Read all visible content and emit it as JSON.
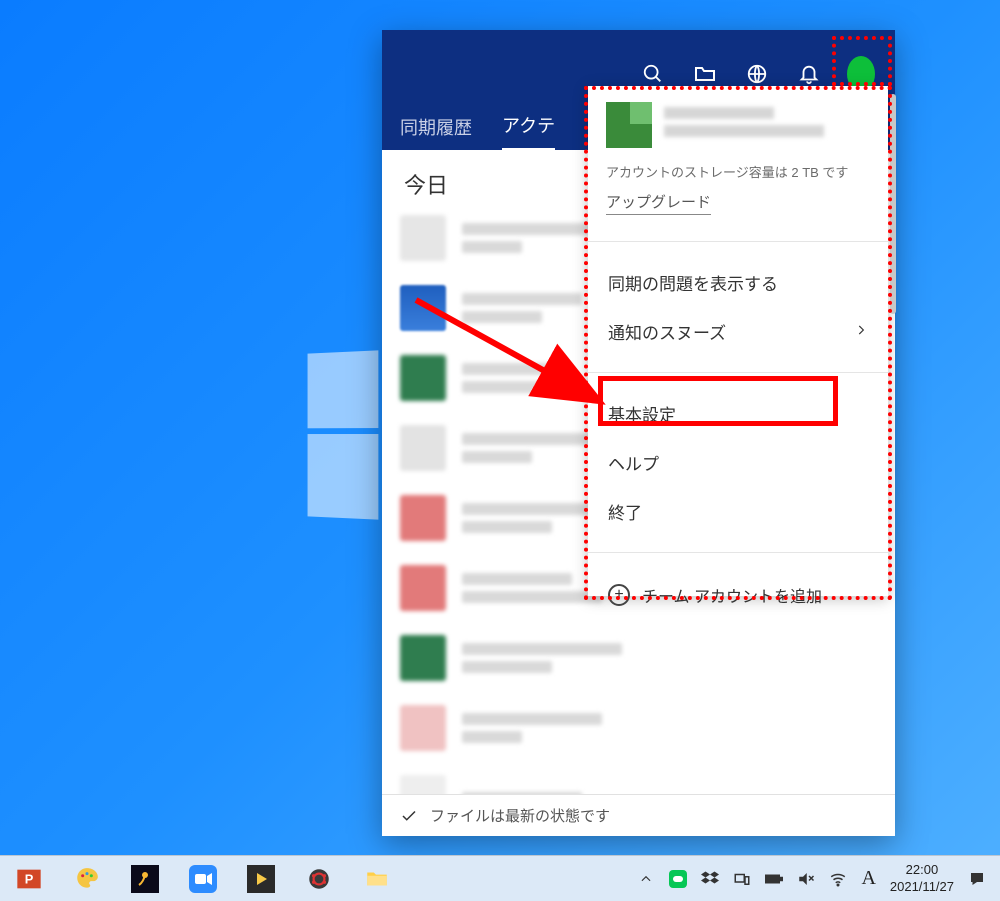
{
  "dropbox": {
    "tabs": {
      "sync_history": "同期履歴",
      "activity": "アクテ"
    },
    "section_today": "今日",
    "footer_status": "ファイルは最新の状態です"
  },
  "account_menu": {
    "storage_text": "アカウントのストレージ容量は 2 TB です",
    "upgrade": "アップグレード",
    "show_sync_issues": "同期の問題を表示する",
    "snooze_notifications": "通知のスヌーズ",
    "preferences": "基本設定",
    "help": "ヘルプ",
    "quit": "終了",
    "add_team_account": "チーム アカウントを追加"
  },
  "taskbar": {
    "ime": "A",
    "time": "22:00",
    "date": "2021/11/27"
  }
}
